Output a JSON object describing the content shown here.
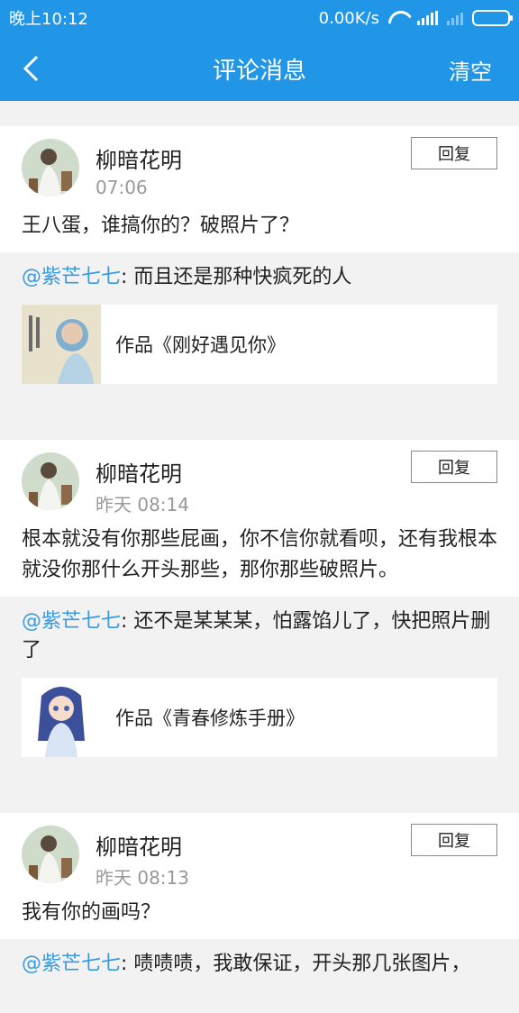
{
  "status_bar": {
    "time": "晚上10:12",
    "net_speed": "0.00K/s"
  },
  "header": {
    "title": "评论消息",
    "clear_label": "清空"
  },
  "messages": [
    {
      "user": "柳暗花明",
      "time": "07:06",
      "reply_label": "回复",
      "comment": "王八蛋，谁搞你的？破照片了？",
      "quote_mention": "@紫芒七七",
      "quote_text": ": 而且还是那种快疯死的人",
      "work_title": "作品《刚好遇见你》"
    },
    {
      "user": "柳暗花明",
      "time": "昨天 08:14",
      "reply_label": "回复",
      "comment": "根本就没有你那些屁画，你不信你就看呗，还有我根本就没你那什么开头那些，那你那些破照片。",
      "quote_mention": "@紫芒七七",
      "quote_text": ": 还不是某某某，怕露馅儿了，快把照片删了",
      "work_title": "作品《青春修炼手册》"
    },
    {
      "user": "柳暗花明",
      "time": "昨天 08:13",
      "reply_label": "回复",
      "comment": "我有你的画吗？",
      "quote_mention": "@紫芒七七",
      "quote_text": ": 啧啧啧，我敢保证，开头那几张图片，"
    }
  ]
}
